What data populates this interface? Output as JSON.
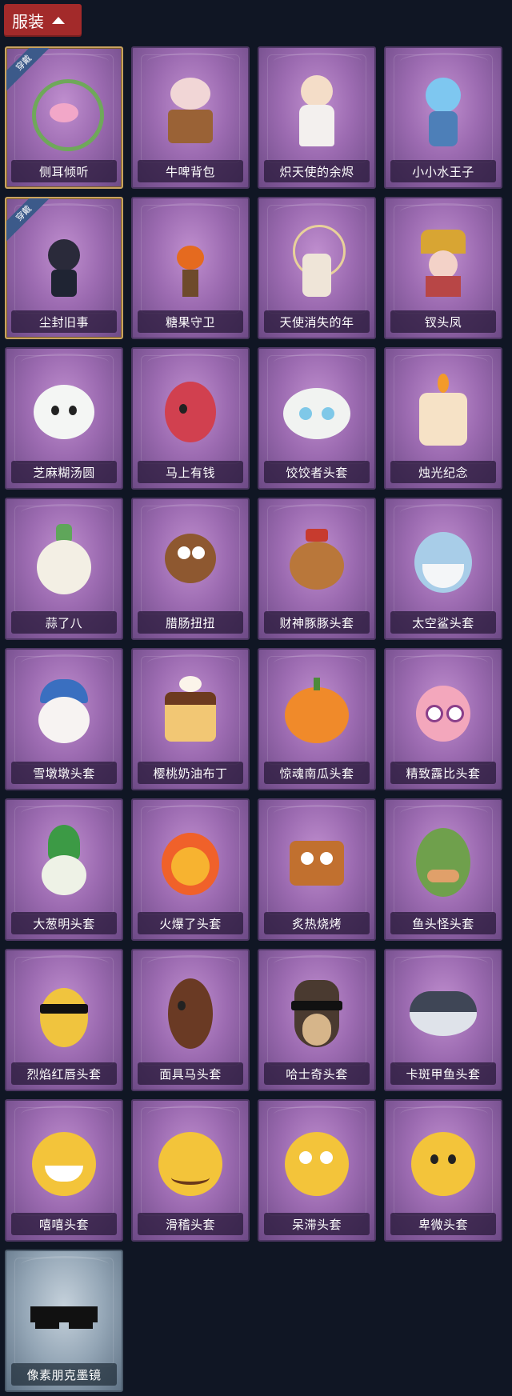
{
  "header": {
    "label": "服装"
  },
  "badge_label": "穿戴",
  "items": [
    {
      "label": "侧耳倾听",
      "icon": "ear-wreath-icon",
      "equipped": true
    },
    {
      "label": "牛啤背包",
      "icon": "cow-beer-backpack-icon"
    },
    {
      "label": "炽天使的余烬",
      "icon": "angel-figure-icon"
    },
    {
      "label": "小小水王子",
      "icon": "water-prince-figure-icon"
    },
    {
      "label": "尘封旧事",
      "icon": "chibi-figure-charm-icon",
      "equipped": true
    },
    {
      "label": "糖果守卫",
      "icon": "pumpkin-scarecrow-charm-icon"
    },
    {
      "label": "天使消失的年",
      "icon": "angel-girl-figure-icon"
    },
    {
      "label": "钗头凤",
      "icon": "phoenix-headdress-icon"
    },
    {
      "label": "芝麻糊汤圆",
      "icon": "rice-ball-head-icon"
    },
    {
      "label": "马上有钱",
      "icon": "red-horse-head-icon"
    },
    {
      "label": "饺饺者头套",
      "icon": "cloud-dumpling-head-icon"
    },
    {
      "label": "烛光纪念",
      "icon": "candle-head-icon"
    },
    {
      "label": "蒜了八",
      "icon": "garlic-head-icon"
    },
    {
      "label": "腊肠扭扭",
      "icon": "dachshund-head-icon"
    },
    {
      "label": "财神豚豚头套",
      "icon": "capybara-head-icon"
    },
    {
      "label": "太空鲨头套",
      "icon": "shark-head-icon"
    },
    {
      "label": "雪墩墩头套",
      "icon": "snowman-head-icon"
    },
    {
      "label": "樱桃奶油布丁",
      "icon": "pudding-head-icon"
    },
    {
      "label": "惊魂南瓜头套",
      "icon": "pumpkin-head-icon"
    },
    {
      "label": "精致露比头套",
      "icon": "pink-beaver-head-icon"
    },
    {
      "label": "大葱明头套",
      "icon": "scallion-head-icon"
    },
    {
      "label": "火爆了头套",
      "icon": "fire-head-icon"
    },
    {
      "label": "炙热烧烤",
      "icon": "bbq-head-icon"
    },
    {
      "label": "鱼头怪头套",
      "icon": "fish-head-icon"
    },
    {
      "label": "烈焰红唇头套",
      "icon": "yellow-mouse-head-icon"
    },
    {
      "label": "面具马头套",
      "icon": "horse-head-icon"
    },
    {
      "label": "哈士奇头套",
      "icon": "husky-head-icon"
    },
    {
      "label": "卡斑甲鱼头套",
      "icon": "pufferfish-head-icon"
    },
    {
      "label": "嘻嘻头套",
      "icon": "grin-emoji-head-icon"
    },
    {
      "label": "滑稽头套",
      "icon": "smirk-emoji-head-icon"
    },
    {
      "label": "呆滞头套",
      "icon": "dazed-emoji-head-icon"
    },
    {
      "label": "卑微头套",
      "icon": "sad-emoji-head-icon"
    },
    {
      "label": "像素朋克墨镜",
      "icon": "pixel-sunglasses-icon",
      "grey": true
    }
  ]
}
